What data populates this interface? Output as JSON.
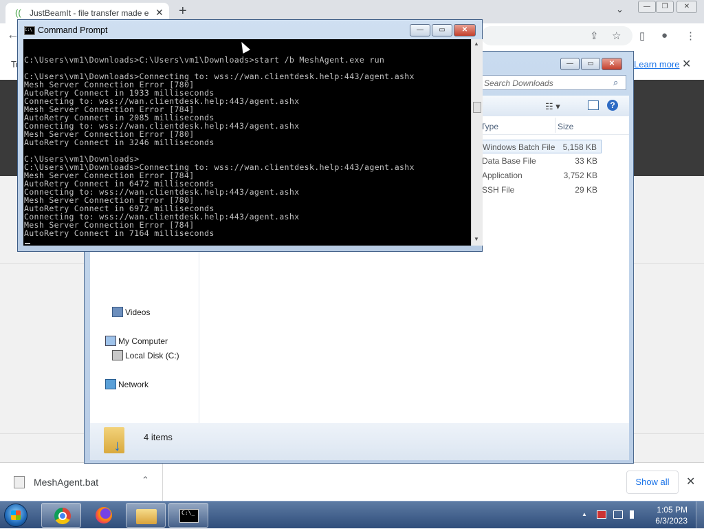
{
  "chrome": {
    "tab_title": "JustBeamIt - file transfer made e",
    "tab_close": "✕",
    "new_tab": "+",
    "tab_search": "⌄",
    "win_min": "—",
    "win_max": "❐",
    "win_close": "✕",
    "back": "←",
    "share_icon": "⇪",
    "star_icon": "☆",
    "sidepanel_icon": "▯",
    "profile_icon": "●",
    "menu_icon": "⋮",
    "infobar_left": "To",
    "learn_more": "Learn more",
    "infobar_close": "✕"
  },
  "download_bar": {
    "file_name": "MeshAgent.bat",
    "chevron": "⌃",
    "show_all": "Show all",
    "close": "✕"
  },
  "cmd": {
    "title": "Command Prompt",
    "icon_text": "C:\\",
    "lines": [
      "C:\\Users\\vm1\\Downloads>C:\\Users\\vm1\\Downloads>start /b MeshAgent.exe run",
      "",
      "C:\\Users\\vm1\\Downloads>Connecting to: wss://wan.clientdesk.help:443/agent.ashx",
      "Mesh Server Connection Error [780]",
      "AutoRetry Connect in 1933 milliseconds",
      "Connecting to: wss://wan.clientdesk.help:443/agent.ashx",
      "Mesh Server Connection Error [784]",
      "AutoRetry Connect in 2085 milliseconds",
      "Connecting to: wss://wan.clientdesk.help:443/agent.ashx",
      "Mesh Server Connection Error [780]",
      "AutoRetry Connect in 3246 milliseconds",
      "",
      "C:\\Users\\vm1\\Downloads>",
      "C:\\Users\\vm1\\Downloads>Connecting to: wss://wan.clientdesk.help:443/agent.ashx",
      "Mesh Server Connection Error [784]",
      "AutoRetry Connect in 6472 milliseconds",
      "Connecting to: wss://wan.clientdesk.help:443/agent.ashx",
      "Mesh Server Connection Error [780]",
      "AutoRetry Connect in 6972 milliseconds",
      "Connecting to: wss://wan.clientdesk.help:443/agent.ashx",
      "Mesh Server Connection Error [784]",
      "AutoRetry Connect in 7164 milliseconds"
    ]
  },
  "explorer": {
    "search_placeholder": "Search Downloads",
    "search_icon": "⌕",
    "views_icon": "☷ ▾",
    "help_icon": "?",
    "columns": {
      "type": "Type",
      "size": "Size"
    },
    "files": [
      {
        "type": "Windows Batch File",
        "size": "5,158 KB"
      },
      {
        "type": "Data Base File",
        "size": "33 KB"
      },
      {
        "type": "Application",
        "size": "3,752 KB"
      },
      {
        "type": "SSH File",
        "size": "29 KB"
      }
    ],
    "nav": {
      "videos": "Videos",
      "my_computer": "My Computer",
      "local_disk": "Local Disk (C:)",
      "network": "Network"
    },
    "items_count": "4 items",
    "details_arrow": "↓"
  },
  "taskbar": {
    "cmd_logo_text": "C:\\_",
    "clock_time": "1:05 PM",
    "clock_date": "6/3/2023",
    "tray_up": "▲"
  }
}
